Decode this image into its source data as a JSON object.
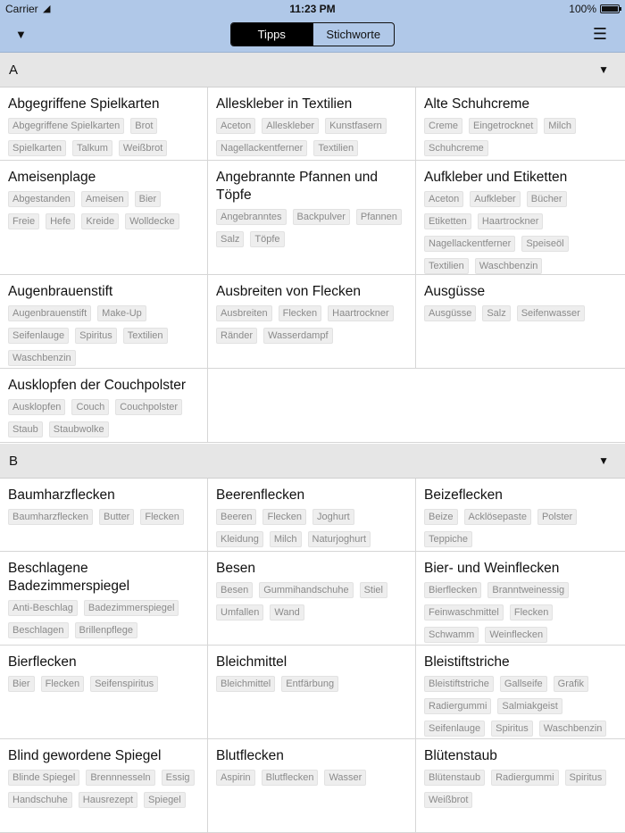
{
  "status": {
    "carrier": "Carrier",
    "time": "11:23 PM",
    "battery": "100%",
    "battery_level": 1.0
  },
  "nav": {
    "left_icon": "triangle-down-icon",
    "right_icon": "list-icon",
    "tabs": [
      {
        "label": "Tipps",
        "active": true
      },
      {
        "label": "Stichworte",
        "active": false
      }
    ]
  },
  "sections": [
    {
      "letter": "A",
      "rows": [
        [
          {
            "title": "Abgegriffene Spielkarten",
            "tags": [
              "Abgegriffene Spielkarten",
              "Brot",
              "Spielkarten",
              "Talkum",
              "Weißbrot"
            ]
          },
          {
            "title": "Alleskleber in Textilien",
            "tags": [
              "Aceton",
              "Alleskleber",
              "Kunstfasern",
              "Nagellackentferner",
              "Textilien"
            ]
          },
          {
            "title": "Alte Schuhcreme",
            "tags": [
              "Creme",
              "Eingetrocknet",
              "Milch",
              "Schuhcreme"
            ]
          }
        ],
        [
          {
            "title": "Ameisenplage",
            "tags": [
              "Abgestanden",
              "Ameisen",
              "Bier",
              "Freie",
              "Hefe",
              "Kreide",
              "Wolldecke"
            ]
          },
          {
            "title": "Angebrannte Pfannen und Töpfe",
            "tags": [
              "Angebranntes",
              "Backpulver",
              "Pfannen",
              "Salz",
              "Töpfe"
            ]
          },
          {
            "title": "Aufkleber und Etiketten",
            "tags": [
              "Aceton",
              "Aufkleber",
              "Bücher",
              "Etiketten",
              "Haartrockner",
              "Nagellackentferner",
              "Speiseöl",
              "Textilien",
              "Waschbenzin"
            ]
          }
        ],
        [
          {
            "title": "Augenbrauenstift",
            "tags": [
              "Augenbrauenstift",
              "Make-Up",
              "Seifenlauge",
              "Spiritus",
              "Textilien",
              "Waschbenzin"
            ]
          },
          {
            "title": "Ausbreiten von Flecken",
            "tags": [
              "Ausbreiten",
              "Flecken",
              "Haartrockner",
              "Ränder",
              "Wasserdampf"
            ]
          },
          {
            "title": "Ausgüsse",
            "tags": [
              "Ausgüsse",
              "Salz",
              "Seifenwasser"
            ]
          }
        ],
        [
          {
            "title": "Ausklopfen der Couchpolster",
            "tags": [
              "Ausklopfen",
              "Couch",
              "Couchpolster",
              "Staub",
              "Staubwolke"
            ]
          }
        ]
      ]
    },
    {
      "letter": "B",
      "rows": [
        [
          {
            "title": "Baumharzflecken",
            "tags": [
              "Baumharzflecken",
              "Butter",
              "Flecken"
            ]
          },
          {
            "title": "Beerenflecken",
            "tags": [
              "Beeren",
              "Flecken",
              "Joghurt",
              "Kleidung",
              "Milch",
              "Naturjoghurt"
            ]
          },
          {
            "title": "Beizeflecken",
            "tags": [
              "Beize",
              "Acklösepaste",
              "Polster",
              "Teppiche"
            ]
          }
        ],
        [
          {
            "title": "Beschlagene Badezimmerspiegel",
            "tags": [
              "Anti-Beschlag",
              "Badezimmerspiegel",
              "Beschlagen",
              "Brillenpflege"
            ]
          },
          {
            "title": "Besen",
            "tags": [
              "Besen",
              "Gummihandschuhe",
              "Stiel",
              "Umfallen",
              "Wand"
            ]
          },
          {
            "title": "Bier- und Weinflecken",
            "tags": [
              "Bierflecken",
              "Branntweinessig",
              "Feinwaschmittel",
              "Flecken",
              "Schwamm",
              "Weinflecken"
            ]
          }
        ],
        [
          {
            "title": "Bierflecken",
            "tags": [
              "Bier",
              "Flecken",
              "Seifenspiritus"
            ]
          },
          {
            "title": "Bleichmittel",
            "tags": [
              "Bleichmittel",
              "Entfärbung"
            ]
          },
          {
            "title": "Bleistiftstriche",
            "tags": [
              "Bleistiftstriche",
              "Gallseife",
              "Grafik",
              "Radiergummi",
              "Salmiakgeist",
              "Seifenlauge",
              "Spiritus",
              "Waschbenzin"
            ]
          }
        ],
        [
          {
            "title": "Blind gewordene Spiegel",
            "tags": [
              "Blinde Spiegel",
              "Brennnesseln",
              "Essig",
              "Handschuhe",
              "Hausrezept",
              "Spiegel"
            ]
          },
          {
            "title": "Blutflecken",
            "tags": [
              "Aspirin",
              "Blutflecken",
              "Wasser"
            ]
          },
          {
            "title": "Blütenstaub",
            "tags": [
              "Blütenstaub",
              "Radiergummi",
              "Spiritus",
              "Weißbrot"
            ]
          }
        ]
      ]
    }
  ]
}
